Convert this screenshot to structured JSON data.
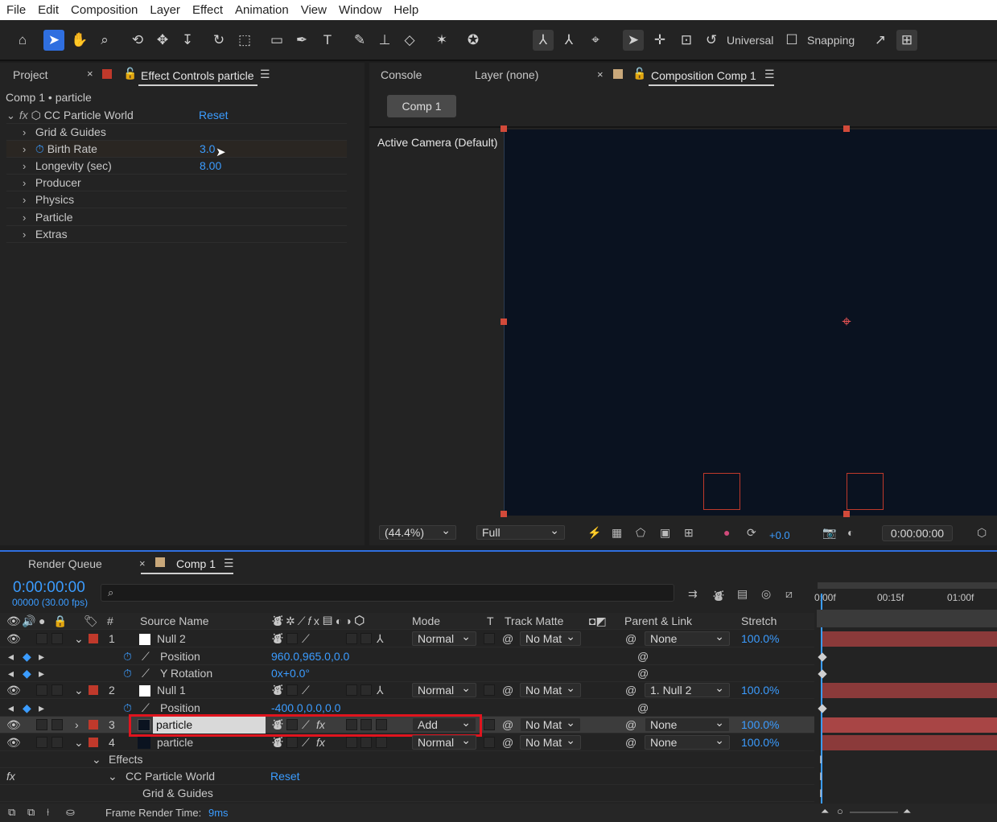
{
  "menu": [
    "File",
    "Edit",
    "Composition",
    "Layer",
    "Effect",
    "Animation",
    "View",
    "Window",
    "Help"
  ],
  "toolbar": {
    "universal_label": "Universal",
    "snapping_label": "Snapping"
  },
  "project_panel": {
    "tab_project": "Project",
    "tab_effect_controls": "Effect Controls particle",
    "breadcrumb": "Comp 1 • particle",
    "effect_name": "CC Particle World",
    "reset_label": "Reset",
    "rows": [
      {
        "label": "Grid & Guides",
        "value": ""
      },
      {
        "label": "Birth Rate",
        "value": "3.0"
      },
      {
        "label": "Longevity (sec)",
        "value": "8.00"
      },
      {
        "label": "Producer",
        "value": ""
      },
      {
        "label": "Physics",
        "value": ""
      },
      {
        "label": "Particle",
        "value": ""
      },
      {
        "label": "Extras",
        "value": ""
      }
    ]
  },
  "comp_panel": {
    "tab_console": "Console",
    "tab_layer": "Layer (none)",
    "tab_composition": "Composition Comp 1",
    "comp_button": "Comp 1",
    "camera_label": "Active Camera (Default)",
    "zoom": "(44.4%)",
    "resolution": "Full",
    "exposure": "+0.0",
    "timecode": "0:00:00:00"
  },
  "timeline": {
    "tab_render_queue": "Render Queue",
    "tab_comp": "Comp 1",
    "timecode": "0:00:00:00",
    "frame_info": "00000 (30.00 fps)",
    "search_placeholder": "",
    "ruler": [
      "0:00f",
      "00:15f",
      "01:00f"
    ],
    "headers": {
      "num": "#",
      "source": "Source Name",
      "mode": "Mode",
      "t": "T",
      "track_matte": "Track Matte",
      "parent": "Parent & Link",
      "stretch": "Stretch"
    },
    "layers": [
      {
        "num": "1",
        "name": "Null 2",
        "mode": "Normal",
        "matte": "No Mat",
        "parent": "None",
        "stretch": "100.0%"
      },
      {
        "prop": "Position",
        "value": "960.0,965.0,0.0"
      },
      {
        "prop": "Y Rotation",
        "value": "0x+0.0°"
      },
      {
        "num": "2",
        "name": "Null 1",
        "mode": "Normal",
        "matte": "No Mat",
        "parent": "1. Null 2",
        "stretch": "100.0%"
      },
      {
        "prop": "Position",
        "value": "-400.0,0.0,0.0"
      },
      {
        "num": "3",
        "name": "particle",
        "mode": "Add",
        "matte": "No Mat",
        "parent": "None",
        "stretch": "100.0%"
      },
      {
        "num": "4",
        "name": "particle",
        "mode": "Normal",
        "matte": "No Mat",
        "parent": "None",
        "stretch": "100.0%"
      }
    ],
    "effects_label": "Effects",
    "effect_name": "CC Particle World",
    "effect_reset": "Reset",
    "effect_child": "Grid & Guides",
    "frame_render_label": "Frame Render Time:",
    "frame_render_value": "9ms"
  },
  "colors": {
    "accent": "#3b9cff",
    "layer_label_red": "#c0392b",
    "highlight_box": "#e0141e",
    "track_bar": "#8b3a3a",
    "viewer_bg": "#0a1220"
  }
}
